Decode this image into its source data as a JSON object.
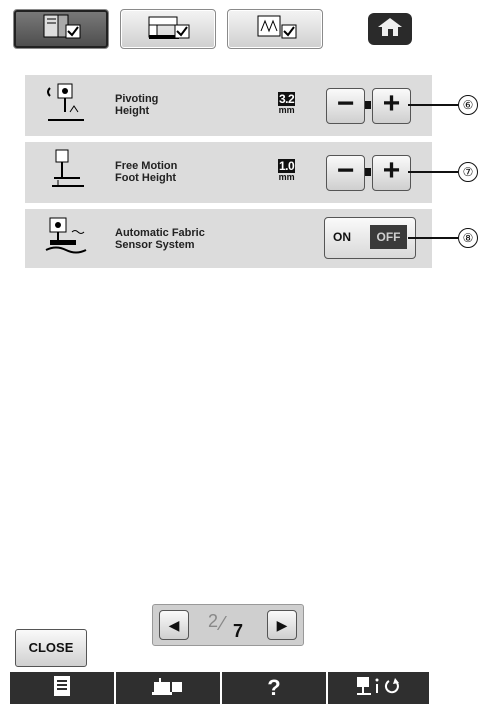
{
  "rows": [
    {
      "label_line1": "Pivoting",
      "label_line2": "Height",
      "value": "3.2",
      "unit": "mm",
      "callout": "⑥"
    },
    {
      "label_line1": "Free Motion",
      "label_line2": "Foot Height",
      "value": "1.0",
      "unit": "mm",
      "callout": "⑦"
    },
    {
      "label_line1": "Automatic Fabric",
      "label_line2": "Sensor System",
      "callout": "⑧",
      "toggle_on": "ON",
      "toggle_off": "OFF",
      "toggle_state": "OFF"
    }
  ],
  "controls": {
    "minus": "−",
    "plus": "+"
  },
  "pager": {
    "current": "2",
    "total": "7",
    "prev": "◀",
    "next": "▶"
  },
  "close_label": "CLOSE",
  "bottom": {
    "help": "?"
  },
  "icons": {
    "tab1": "settings-book-icon",
    "tab2": "machine-settings-icon",
    "tab3": "embroidery-settings-icon",
    "home": "home-icon",
    "bottom1": "document-icon",
    "bottom2": "machine-icon",
    "bottom4": "presser-foot-info-icon"
  }
}
